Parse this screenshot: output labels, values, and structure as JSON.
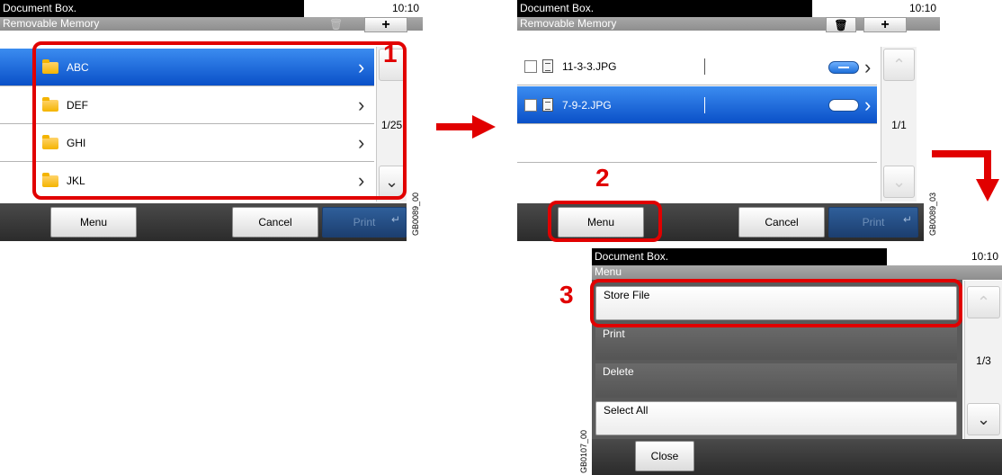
{
  "screen1": {
    "title": "Document Box.",
    "time": "10:10",
    "subtitle": "Removable Memory",
    "add_button": "+",
    "folders": [
      {
        "label": "ABC",
        "selected": true
      },
      {
        "label": "DEF",
        "selected": false
      },
      {
        "label": "GHI",
        "selected": false
      },
      {
        "label": "JKL",
        "selected": false
      }
    ],
    "page": "1/25",
    "buttons": {
      "menu": "Menu",
      "cancel": "Cancel",
      "print": "Print"
    },
    "step": "1",
    "code": "GB0089_00"
  },
  "screen2": {
    "title": "Document Box.",
    "time": "10:10",
    "subtitle": "Removable Memory",
    "add_button": "+",
    "files": [
      {
        "label": "11-3-3.JPG",
        "selected": false
      },
      {
        "label": "7-9-2.JPG",
        "selected": true
      }
    ],
    "page": "1/1",
    "buttons": {
      "menu": "Menu",
      "cancel": "Cancel",
      "print": "Print"
    },
    "step": "2",
    "code": "GB0089_03"
  },
  "screen3": {
    "title": "Document Box.",
    "time": "10:10",
    "subtitle": "Menu",
    "items": [
      {
        "label": "Store File",
        "style": "light"
      },
      {
        "label": "Print",
        "style": "dark"
      },
      {
        "label": "Delete",
        "style": "dark"
      },
      {
        "label": "Select All",
        "style": "light"
      }
    ],
    "page": "1/3",
    "buttons": {
      "close": "Close"
    },
    "step": "3",
    "code": "GB0107_00"
  },
  "colors": {
    "accent_red": "#e10000",
    "selection_blue": "#0a50c8"
  },
  "icons": [
    "folder-icon",
    "file-icon",
    "checkbox-icon",
    "trash-icon",
    "plus-icon",
    "chevron-right-icon",
    "chevron-up-icon",
    "chevron-down-icon",
    "enter-icon",
    "arrow-right-icon",
    "arrow-down-icon"
  ]
}
